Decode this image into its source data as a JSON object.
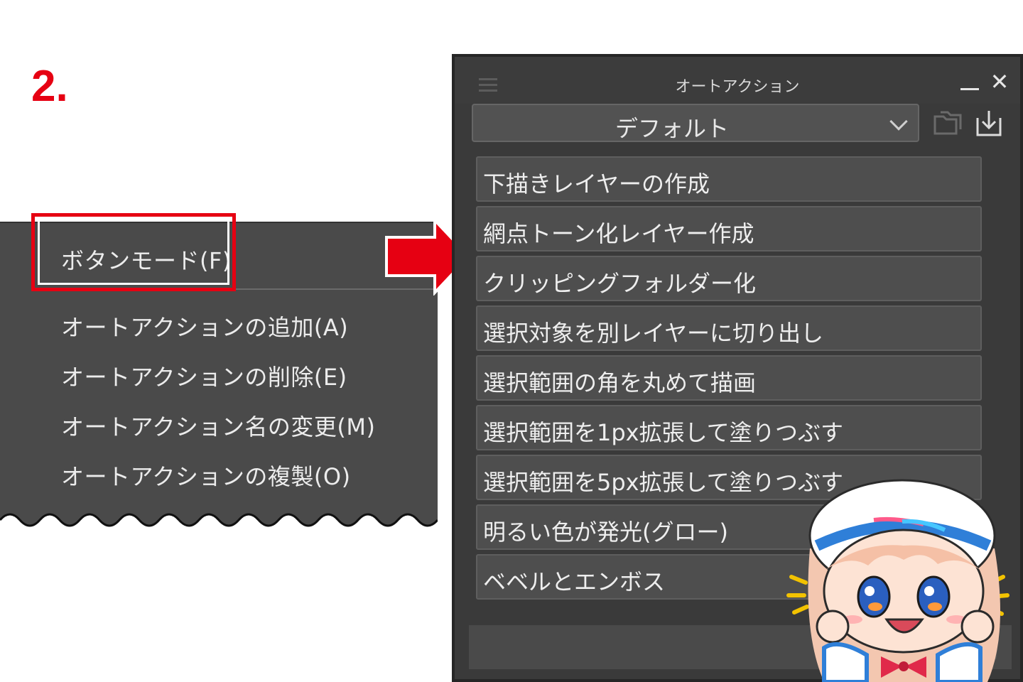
{
  "step_label": "2.",
  "menu": {
    "items": [
      "ボタンモード(F)",
      "オートアクションの追加(A)",
      "オートアクションの削除(E)",
      "オートアクション名の変更(M)",
      "オートアクションの複製(O)"
    ]
  },
  "panel": {
    "title": "オートアクション",
    "set_name": "デフォルト",
    "actions": [
      "下描きレイヤーの作成",
      "網点トーン化レイヤー作成",
      "クリッピングフォルダー化",
      "選択対象を別レイヤーに切り出し",
      "選択範囲の角を丸めて描画",
      "選択範囲を1px拡張して塗りつぶす",
      "選択範囲を5px拡張して塗りつぶす",
      "明るい色が発光(グロー)",
      "ベベルとエンボス"
    ],
    "icons": {
      "menu": "hamburger-icon",
      "minimize": "minimize-icon",
      "close": "close-icon",
      "dropdown": "chevron-down-icon",
      "folder": "folder-icon",
      "import": "import-icon",
      "delete": "trash-icon"
    }
  },
  "colors": {
    "highlight": "#e60012",
    "arrow": "#e60012",
    "panel_bg": "#3a3a3a",
    "menu_bg": "#4a4a4a"
  }
}
